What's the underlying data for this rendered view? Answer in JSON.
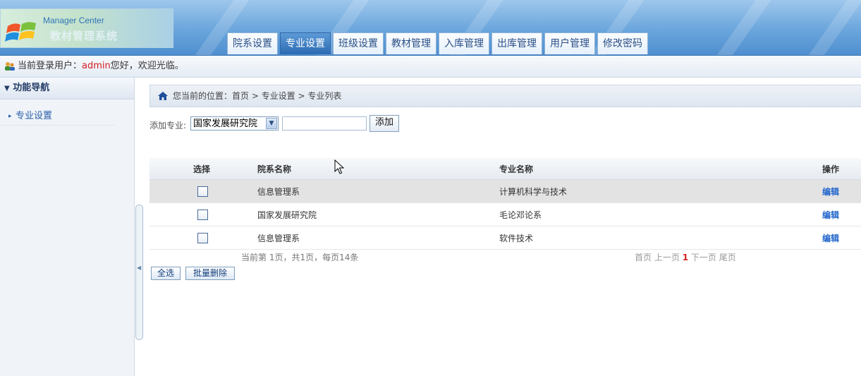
{
  "header": {
    "app_title": "Manager Center",
    "app_subtitle": "教材管理系统",
    "tabs": [
      {
        "label": "院系设置",
        "active": false
      },
      {
        "label": "专业设置",
        "active": true
      },
      {
        "label": "班级设置",
        "active": false
      },
      {
        "label": "教材管理",
        "active": false
      },
      {
        "label": "入库管理",
        "active": false
      },
      {
        "label": "出库管理",
        "active": false
      },
      {
        "label": "用户管理",
        "active": false
      },
      {
        "label": "修改密码",
        "active": false
      }
    ]
  },
  "userbar": {
    "prefix": "当前登录用户：",
    "username": "admin",
    "suffix": "您好，欢迎光临。"
  },
  "sidebar": {
    "heading": "功能导航",
    "items": [
      {
        "label": "专业设置"
      }
    ]
  },
  "breadcrumb": "您当前的位置：首页 > 专业设置 > 专业列表",
  "add_form": {
    "label": "添加专业:",
    "selected_department": "国家发展研究院",
    "input_value": "",
    "add_button": "添加"
  },
  "table": {
    "headers": {
      "select": "选择",
      "department": "院系名称",
      "major": "专业名称",
      "action": "操作"
    },
    "rows": [
      {
        "department": "信息管理系",
        "major": "计算机科学与技术",
        "action": "编辑",
        "highlighted": true
      },
      {
        "department": "国家发展研究院",
        "major": "毛论邓论系",
        "action": "编辑",
        "highlighted": false
      },
      {
        "department": "信息管理系",
        "major": "软件技术",
        "action": "编辑",
        "highlighted": false
      }
    ]
  },
  "pagination": {
    "info": "当前第 1页，共1页，每页14条",
    "first": "首页",
    "prev": "上一页",
    "current": "1",
    "next": "下一页",
    "last": "尾页"
  },
  "bulk_actions": {
    "select_all": "全选",
    "batch_delete": "批量删除"
  },
  "colors": {
    "accent": "#2c6bb3",
    "link": "#2266cc",
    "highlight_red": "#d32020"
  }
}
